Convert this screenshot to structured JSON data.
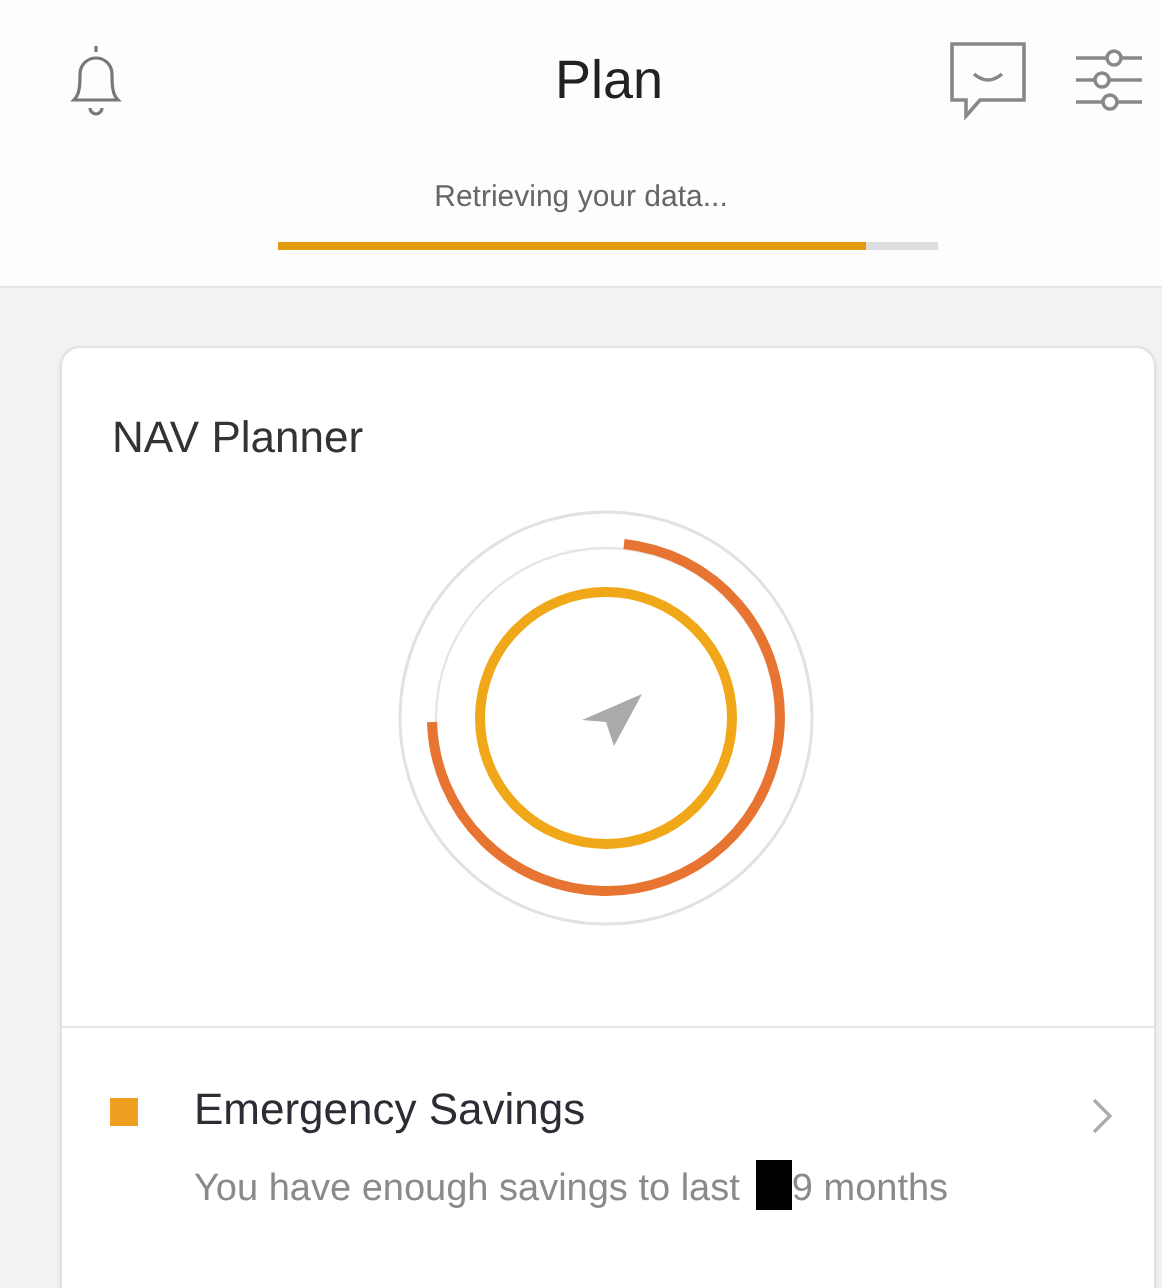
{
  "header": {
    "title": "Plan"
  },
  "loading": {
    "message": "Retrieving your data...",
    "level": 0.89
  },
  "card": {
    "title": "NAV Planner",
    "items": [
      {
        "title": "Emergency Savings",
        "color": "#f0a020",
        "description_before": "You have enough savings to last",
        "description_after": "9 months"
      }
    ]
  }
}
